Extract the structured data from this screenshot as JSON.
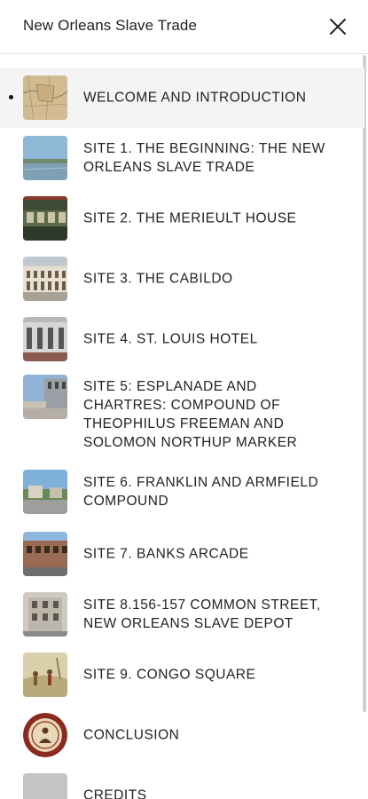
{
  "header": {
    "title": "New Orleans Slave Trade",
    "close_icon": "close-icon"
  },
  "toc": {
    "items": [
      {
        "label": "WELCOME AND INTRODUCTION",
        "active": true,
        "thumb": "map-thumbnail"
      },
      {
        "label": "SITE 1. THE BEGINNING: THE NEW ORLEANS SLAVE TRADE",
        "active": false,
        "thumb": "river-thumbnail"
      },
      {
        "label": "SITE 2. THE MERIEULT HOUSE",
        "active": false,
        "thumb": "building-thumbnail"
      },
      {
        "label": "SITE 3. THE CABILDO",
        "active": false,
        "thumb": "cabildo-thumbnail"
      },
      {
        "label": "SITE 4. ST. LOUIS HOTEL",
        "active": false,
        "thumb": "hotel-thumbnail"
      },
      {
        "label": "SITE 5: ESPLANADE AND CHARTRES: COMPOUND OF THEOPHILUS FREEMAN AND SOLOMON NORTHUP MARKER",
        "active": false,
        "thumb": "street-corner-thumbnail"
      },
      {
        "label": "SITE 6. FRANKLIN AND ARMFIELD COMPOUND",
        "active": false,
        "thumb": "street-thumbnail"
      },
      {
        "label": "SITE 7. BANKS ARCADE",
        "active": false,
        "thumb": "arcade-thumbnail"
      },
      {
        "label": "SITE 8.156-157 COMMON STREET, NEW ORLEANS SLAVE DEPOT",
        "active": false,
        "thumb": "depot-thumbnail"
      },
      {
        "label": "SITE 9. CONGO SQUARE",
        "active": false,
        "thumb": "painting-thumbnail"
      },
      {
        "label": "CONCLUSION",
        "active": false,
        "thumb": "seal-thumbnail"
      },
      {
        "label": "CREDITS",
        "active": false,
        "thumb": "placeholder-thumbnail"
      }
    ]
  }
}
